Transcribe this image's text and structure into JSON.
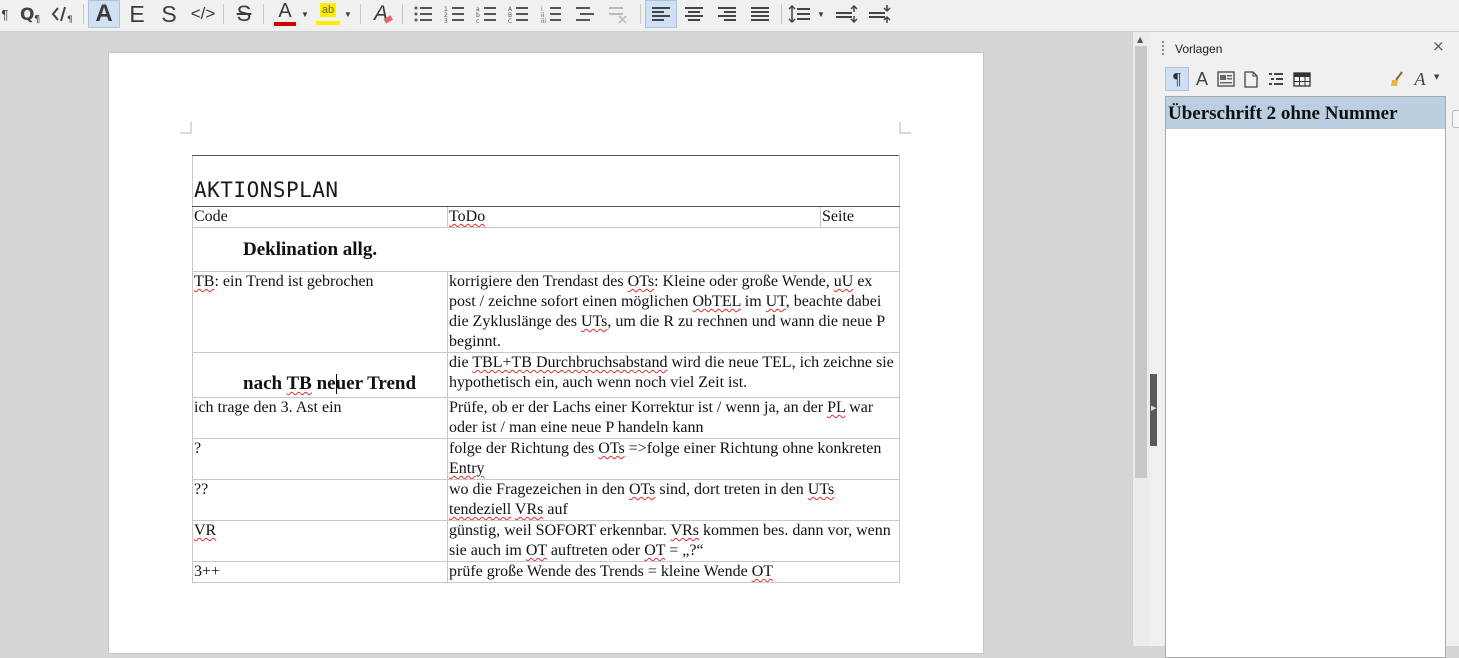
{
  "toolbar": {
    "font_a": "A",
    "font_e": "E",
    "font_s": "S",
    "code": "</>",
    "strike": "S",
    "font_color_letter": "A",
    "highlight_letter": "ab",
    "clear_letter": "A",
    "colors": {
      "font_color": "#cc0000",
      "highlight": "#ffee00",
      "active_bg": "#cfe0f2"
    }
  },
  "document": {
    "title": "AKTIONSPLAN",
    "headers": {
      "code": "Code",
      "todo": "ToDo",
      "page": "Seite"
    },
    "heading1": "Deklination allg.",
    "row1": {
      "code_wavy": "TB",
      "code_rest": ": ein Trend ist gebrochen",
      "todo_1": "korrigiere den Trendast des ",
      "todo_2": "OTs",
      "todo_3": ": Kleine oder große Wende, ",
      "todo_4": "uU",
      "todo_5": " ex post / zeichne sofort einen möglichen ",
      "todo_6": "ObTEL",
      "todo_7": " im ",
      "todo_8": "UT",
      "todo_9": ", beachte dabei die Zykluslänge des ",
      "todo_10": "UTs",
      "todo_11": ", um die R zu rechnen und wann die neue P beginnt."
    },
    "row2": {
      "heading_1": "nach ",
      "heading_2": "TB",
      "heading_3": " neuer Trend",
      "todo_1": "die ",
      "todo_2": "TBL+TB Durchbruchsabstand",
      "todo_3": " wird die neue TEL, ich zeichne sie hypothetisch ein, auch wenn noch viel Zeit ist."
    },
    "row3": {
      "code": "ich trage den 3. Ast ein",
      "todo_1": "Prüfe, ob er der Lachs einer Korrektur ist / wenn ja, an der ",
      "todo_2": "PL",
      "todo_3": " war oder ist / man eine neue P handeln kann"
    },
    "row4": {
      "code": "?",
      "todo_1": "folge der Richtung des ",
      "todo_2": "OTs",
      "todo_3": " =>folge einer Richtung ohne konkreten ",
      "todo_4": "Entry"
    },
    "row5": {
      "code": "??",
      "todo_1": "wo die Fragezeichen in den ",
      "todo_2": "OTs",
      "todo_3": " sind, dort treten in den ",
      "todo_4": "UTs",
      "todo_5": " ",
      "todo_6": "tendeziell",
      "todo_7": " ",
      "todo_8": "VRs",
      "todo_9": " auf"
    },
    "row6": {
      "code": "VR",
      "todo_1": "günstig, weil SOFORT erkennbar. ",
      "todo_2": "VRs",
      "todo_3": " kommen bes. dann vor, wenn sie auch im ",
      "todo_4": "OT",
      "todo_5": " auftreten oder ",
      "todo_6": "OT",
      "todo_7": " = „?“"
    },
    "row7": {
      "code": "3++",
      "todo_1": "prüfe große Wende des Trends = kleine Wende ",
      "todo_2": "OT"
    }
  },
  "sidebar": {
    "title": "Vorlagen",
    "close": "×",
    "selected_style": "Überschrift 2 ohne Nummer",
    "colors": {
      "selected_bg": "#bccfe0"
    }
  }
}
